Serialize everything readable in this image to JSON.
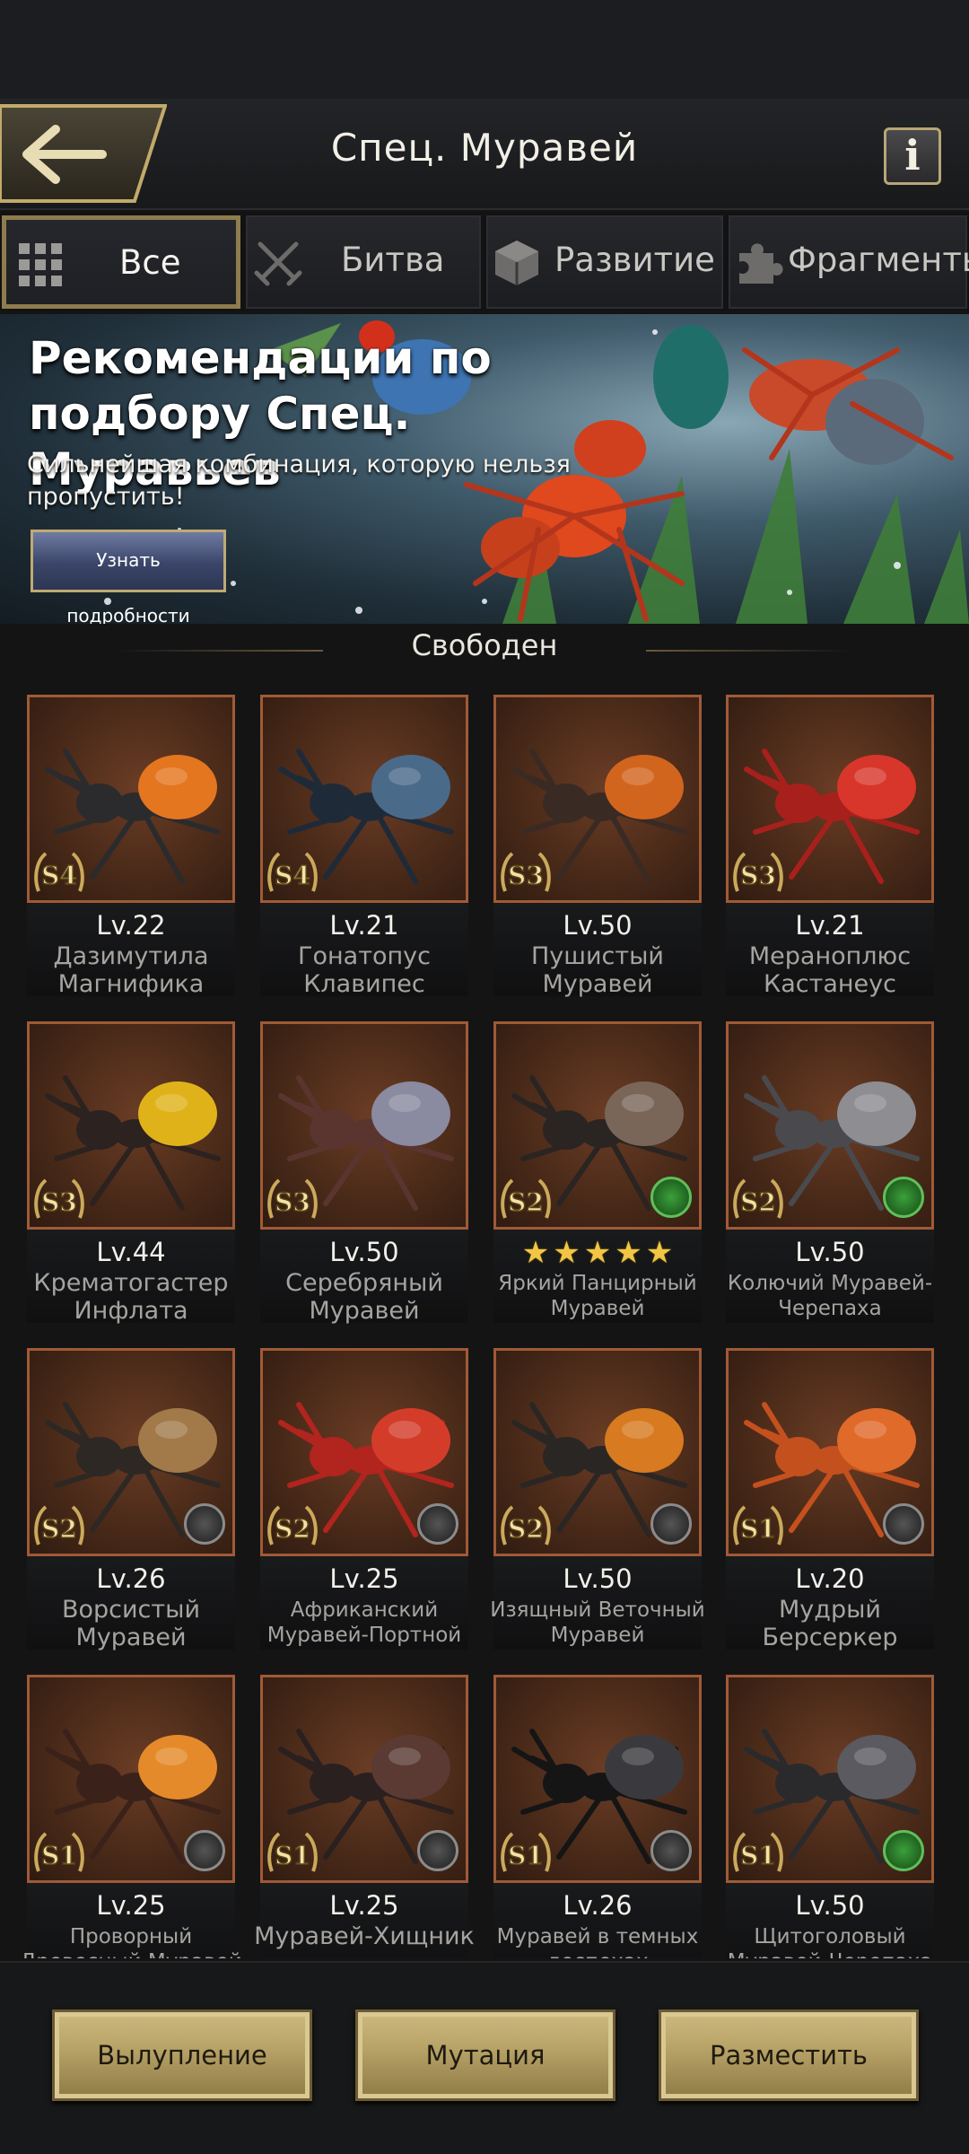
{
  "header": {
    "title": "Спец. Муравей",
    "info_label": "i"
  },
  "tabs": [
    {
      "label": "Все",
      "active": true
    },
    {
      "label": "Битва",
      "active": false
    },
    {
      "label": "Развитие",
      "active": false
    },
    {
      "label": "Фрагменты",
      "active": false
    }
  ],
  "banner": {
    "title": "Рекомендации по подбору Спец. Муравьев",
    "subtitle": "Сильнейшая комбинация, которую нельзя пропустить!",
    "button_label": "Узнать подробности"
  },
  "group": {
    "label": "Свободен"
  },
  "ants": [
    {
      "level": "Lv.22",
      "name": "Дазимутила Магнифика",
      "tier": "S4",
      "trait": "none",
      "color": "#2b2b2d",
      "accent": "#e4761f"
    },
    {
      "level": "Lv.21",
      "name": "Гонатопус Клавипес",
      "tier": "S4",
      "trait": "none",
      "color": "#1f2a38",
      "accent": "#4a6a8a"
    },
    {
      "level": "Lv.50",
      "name": "Пушистый Муравей",
      "tier": "S3",
      "trait": "none",
      "color": "#3a2a24",
      "accent": "#d2651e"
    },
    {
      "level": "Lv.21",
      "name": "Мераноплюс Кастанеус",
      "tier": "S3",
      "trait": "none",
      "color": "#a8201c",
      "accent": "#d8362a"
    },
    {
      "level": "Lv.44",
      "name": "Крематогастер Инфлата",
      "tier": "S3",
      "trait": "none",
      "color": "#2c2220",
      "accent": "#e0b21a"
    },
    {
      "level": "Lv.50",
      "name": "Серебряный Муравей",
      "tier": "S3",
      "trait": "none",
      "color": "#5a3530",
      "accent": "#8a8aa0"
    },
    {
      "level": "",
      "stars": 5,
      "name": "Яркий Панцирный Муравей",
      "tier": "S2",
      "trait": "green",
      "color": "#2a2422",
      "accent": "#7a6658"
    },
    {
      "level": "Lv.50",
      "name": "Колючий Муравей-Черепаха",
      "tier": "S2",
      "trait": "green",
      "color": "#4a4a4e",
      "accent": "#8d8d92"
    },
    {
      "level": "Lv.26",
      "name": "Ворсистый Муравей",
      "tier": "S2",
      "trait": "gray",
      "color": "#2e2824",
      "accent": "#a27a4a"
    },
    {
      "level": "Lv.25",
      "name": "Африканский Муравей-Портной",
      "tier": "S2",
      "trait": "gray",
      "color": "#b2241e",
      "accent": "#d43c2a"
    },
    {
      "level": "Lv.50",
      "name": "Изящный Веточный Муравей",
      "tier": "S2",
      "trait": "gray",
      "color": "#2a2624",
      "accent": "#d77a20"
    },
    {
      "level": "Lv.20",
      "name": "Мудрый Берсеркер",
      "tier": "S1",
      "trait": "gray",
      "color": "#c4501e",
      "accent": "#e06a2a"
    },
    {
      "level": "Lv.25",
      "name": "Проворный Древесный Муравей",
      "tier": "S1",
      "trait": "gray",
      "color": "#3a221a",
      "accent": "#e58a2a"
    },
    {
      "level": "Lv.25",
      "name": "Муравей-Хищник",
      "tier": "S1",
      "trait": "gray",
      "color": "#2a2020",
      "accent": "#5a3a32"
    },
    {
      "level": "Lv.26",
      "name": "Муравей в темных доспехах",
      "tier": "S1",
      "trait": "gray",
      "color": "#151516",
      "accent": "#3a3a3e"
    },
    {
      "level": "Lv.50",
      "name": "Щитоголовый Муравей-Черепаха",
      "tier": "S1",
      "trait": "green",
      "color": "#2a2a2c",
      "accent": "#5a5a60"
    }
  ],
  "footer": {
    "molt_label": "Вылупление",
    "mutation_label": "Мутация",
    "deploy_label": "Разместить"
  }
}
